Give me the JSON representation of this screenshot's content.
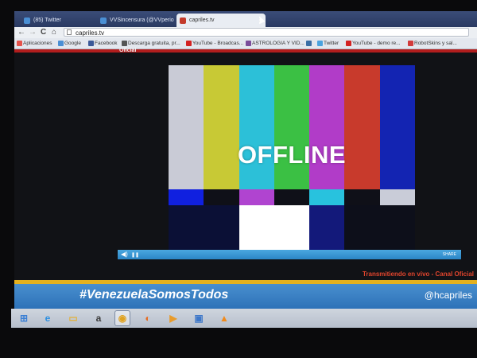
{
  "browser": {
    "tabs": [
      {
        "label": "(85) Twitter",
        "fav_color": "#4a8fd4"
      },
      {
        "label": "VVSincensura (@VVperio",
        "fav_color": "#4a8fd4"
      },
      {
        "label": "capriles.tv",
        "fav_color": "#c33a2a"
      }
    ],
    "nav": {
      "back": "←",
      "forward": "→",
      "reload": "C",
      "home": "⌂"
    },
    "url": "capriles.tv",
    "bookmarks": [
      {
        "label": "Aplicaciones",
        "fav_color": "#e5534b"
      },
      {
        "label": "Google",
        "fav_color": "#4a8fd4"
      },
      {
        "label": "Facebook",
        "fav_color": "#3b5998"
      },
      {
        "label": "Descarga gratuita, pr...",
        "fav_color": "#555"
      },
      {
        "label": "YouTube - Broadcas...",
        "fav_color": "#d32222"
      },
      {
        "label": "ASTROLOGIA Y VID...",
        "fav_color": "#7a4c9a"
      },
      {
        "label": "",
        "fav_color": "#3a6ea5"
      },
      {
        "label": "Twitter",
        "fav_color": "#4aa3df"
      },
      {
        "label": "YouTube - demo re...",
        "fav_color": "#d32222"
      },
      {
        "label": "RobotSkins y sal...",
        "fav_color": "#d23b3b"
      }
    ]
  },
  "page": {
    "oficial_label": "Oficial",
    "offline_text": "OFFLINE",
    "transmit_text": "Transmitiendo en vivo - Canal Oficial",
    "hashtag": "#VenezuelaSomosTodos",
    "handle": "@hcapriles",
    "player_controls": {
      "play": "▶",
      "pause": "❚❚",
      "right_text": "SHARE"
    }
  },
  "colors": {
    "bars": [
      "#c9cbd6",
      "#c8c935",
      "#2cc0d8",
      "#3bc044",
      "#b13cc8",
      "#c83a2c",
      "#1324b2"
    ],
    "mid": [
      "#1020e0",
      "#0f1018",
      "#b044d0",
      "#0f1018",
      "#28c2de",
      "#0f1018",
      "#c9ccd8"
    ],
    "low": [
      "#0b1036",
      "#0b1036",
      "#ffffff",
      "#ffffff",
      "#13197a",
      "#0d0f1a",
      "#0d0f1a"
    ]
  },
  "taskbar": [
    {
      "name": "windows-start-icon",
      "glyph": "⊞",
      "color": "#3a7fd4"
    },
    {
      "name": "internet-explorer-icon",
      "glyph": "e",
      "color": "#2d8fe0"
    },
    {
      "name": "file-explorer-icon",
      "glyph": "▭",
      "color": "#e3b23c"
    },
    {
      "name": "amazon-icon",
      "glyph": "a",
      "color": "#3a3a3a"
    },
    {
      "name": "chrome-icon",
      "glyph": "◉",
      "color": "#e0a21f"
    },
    {
      "name": "firefox-icon",
      "glyph": "◐",
      "color": "#e66b1f"
    },
    {
      "name": "media-player-icon",
      "glyph": "▶",
      "color": "#e89b2a"
    },
    {
      "name": "remote-desktop-icon",
      "glyph": "▣",
      "color": "#3d77c9"
    },
    {
      "name": "vlc-icon",
      "glyph": "▲",
      "color": "#f08a1c"
    }
  ]
}
